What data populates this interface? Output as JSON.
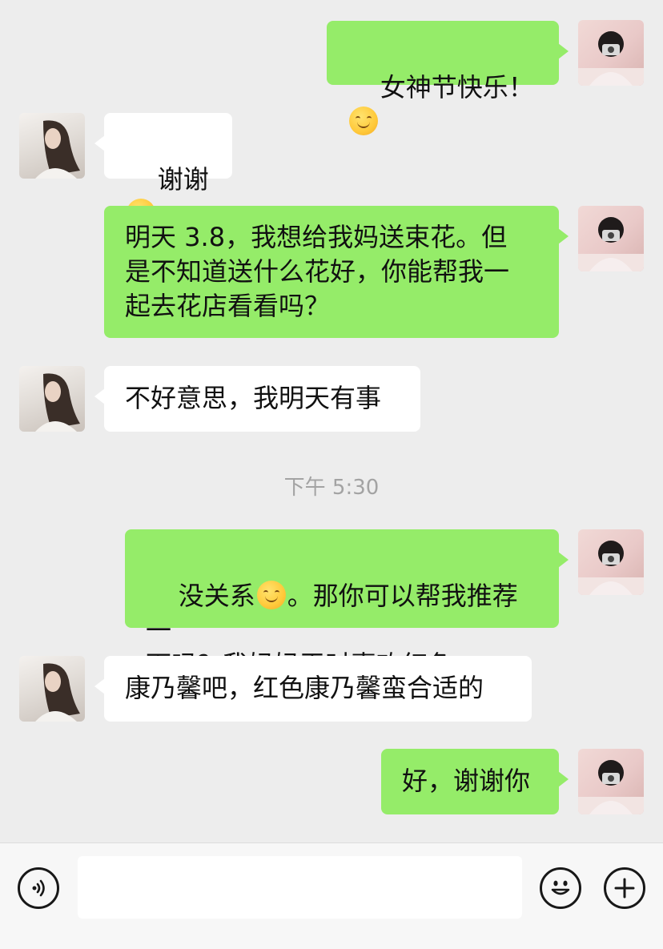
{
  "messages": [
    {
      "from": "me",
      "text_before": "女神节快乐！",
      "has_emoji": true,
      "text_after": ""
    },
    {
      "from": "her",
      "text_before": "谢谢",
      "has_emoji": true,
      "text_after": ""
    },
    {
      "from": "me",
      "text": "明天 3.8，我想给我妈送束花。但\n是不知道送什么花好，你能帮我一\n起去花店看看吗？"
    },
    {
      "from": "her",
      "text": "不好意思，我明天有事"
    },
    {
      "from": "me",
      "text_before": "没关系",
      "has_emoji": true,
      "text_after": "。那你可以帮我推荐一\n下吗？我妈妈平时喜欢红色"
    },
    {
      "from": "her",
      "text": "康乃馨吧，红色康乃馨蛮合适的"
    },
    {
      "from": "me",
      "text": "好，谢谢你"
    }
  ],
  "timestamp": "下午 5:30",
  "input_bar": {
    "voice_icon": "voice-icon",
    "emoji_icon": "emoji-icon",
    "plus_icon": "plus-icon",
    "placeholder": ""
  },
  "colors": {
    "my_bubble": "#95ec69",
    "her_bubble": "#ffffff",
    "background": "#ededed"
  }
}
